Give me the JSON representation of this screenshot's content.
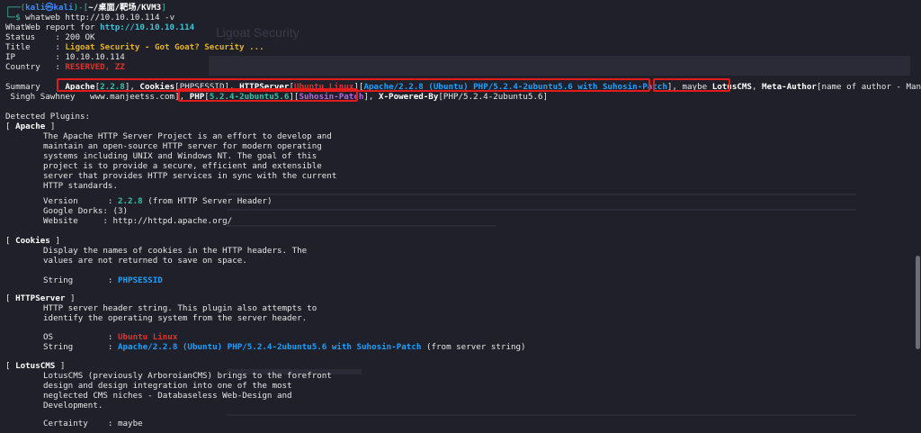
{
  "prompt": {
    "top": "┌──(",
    "user": "kali㉿kali",
    "mid": ")-[",
    "path": "~/桌面/靶场/KVM3",
    "end": "]",
    "arrow": "└─$",
    "command": "whatweb http://10.10.10.114 -v"
  },
  "report": {
    "header_label": "WhatWeb report for ",
    "header_url": "http://10.10.10.114",
    "status_label": "Status    : ",
    "status_value": "200 OK",
    "title_label": "Title     : ",
    "title_value": "Ligoat Security - Got Goat? Security ...",
    "ip_label": "IP        : ",
    "ip_value": "10.10.10.114",
    "country_label": "Country   : ",
    "country_value": "RESERVED, ZZ"
  },
  "summary": {
    "label": "Summary   : ",
    "apache": "Apache",
    "apache_ver": "2.2.8",
    "cookies": "Cookies",
    "cookies_val": "PHPSESSID",
    "httpserver": "HTTPServer",
    "os": "Ubuntu Linux",
    "server_str": "Apache/2.2.8 (Ubuntu) PHP/5.2.4-2ubuntu5.6 with Suhosin-Patch",
    "maybe": "maybe ",
    "lotus": "LotusCMS",
    "meta": "Meta-Author",
    "meta_val": "name of author - Manjeet",
    "line2_start": " Singh Sawhney   www.manjeetss.com",
    "php": "PHP",
    "php_ver": "5.2.4-2ubuntu5.6",
    "suhosin": "Suhosin-Patch",
    "xpb": "X-Powered-By",
    "xpb_val": "PHP/5.2.4-2ubuntu5.6"
  },
  "plugins": {
    "heading": "Detected Plugins:",
    "apache": {
      "name": "Apache",
      "desc": [
        "The Apache HTTP Server Project is an effort to develop and",
        "maintain an open-source HTTP server for modern operating",
        "systems including UNIX and Windows NT. The goal of this",
        "project is to provide a secure, efficient and extensible",
        "server that provides HTTP services in sync with the current",
        "HTTP standards."
      ],
      "version_label": "Version      : ",
      "version_value": "2.2.8",
      "version_note": " (from HTTP Server Header)",
      "dorks": "Google Dorks: (3)",
      "website": "Website     : http://httpd.apache.org/"
    },
    "cookies": {
      "name": "Cookies",
      "desc": [
        "Display the names of cookies in the HTTP headers. The",
        "values are not returned to save on space."
      ],
      "string_label": "String       : ",
      "string_value": "PHPSESSID"
    },
    "httpserver": {
      "name": "HTTPServer",
      "desc": [
        "HTTP server header string. This plugin also attempts to",
        "identify the operating system from the server header."
      ],
      "os_label": "OS           : ",
      "os_value": "Ubuntu Linux",
      "string_label": "String       : ",
      "string_value": "Apache/2.2.8 (Ubuntu) PHP/5.2.4-2ubuntu5.6 with Suhosin-Patch",
      "string_note": " (from server string)"
    },
    "lotus": {
      "name": "LotusCMS",
      "desc": [
        "LotusCMS (previously ArboroianCMS) brings to the forefront",
        "design and design integration into one of the most",
        "neglected CMS niches - Databaseless Web-Design and",
        "Development."
      ],
      "certainty": "Certainty    : maybe"
    }
  },
  "ghost": {
    "title": "Ligoat Security"
  }
}
